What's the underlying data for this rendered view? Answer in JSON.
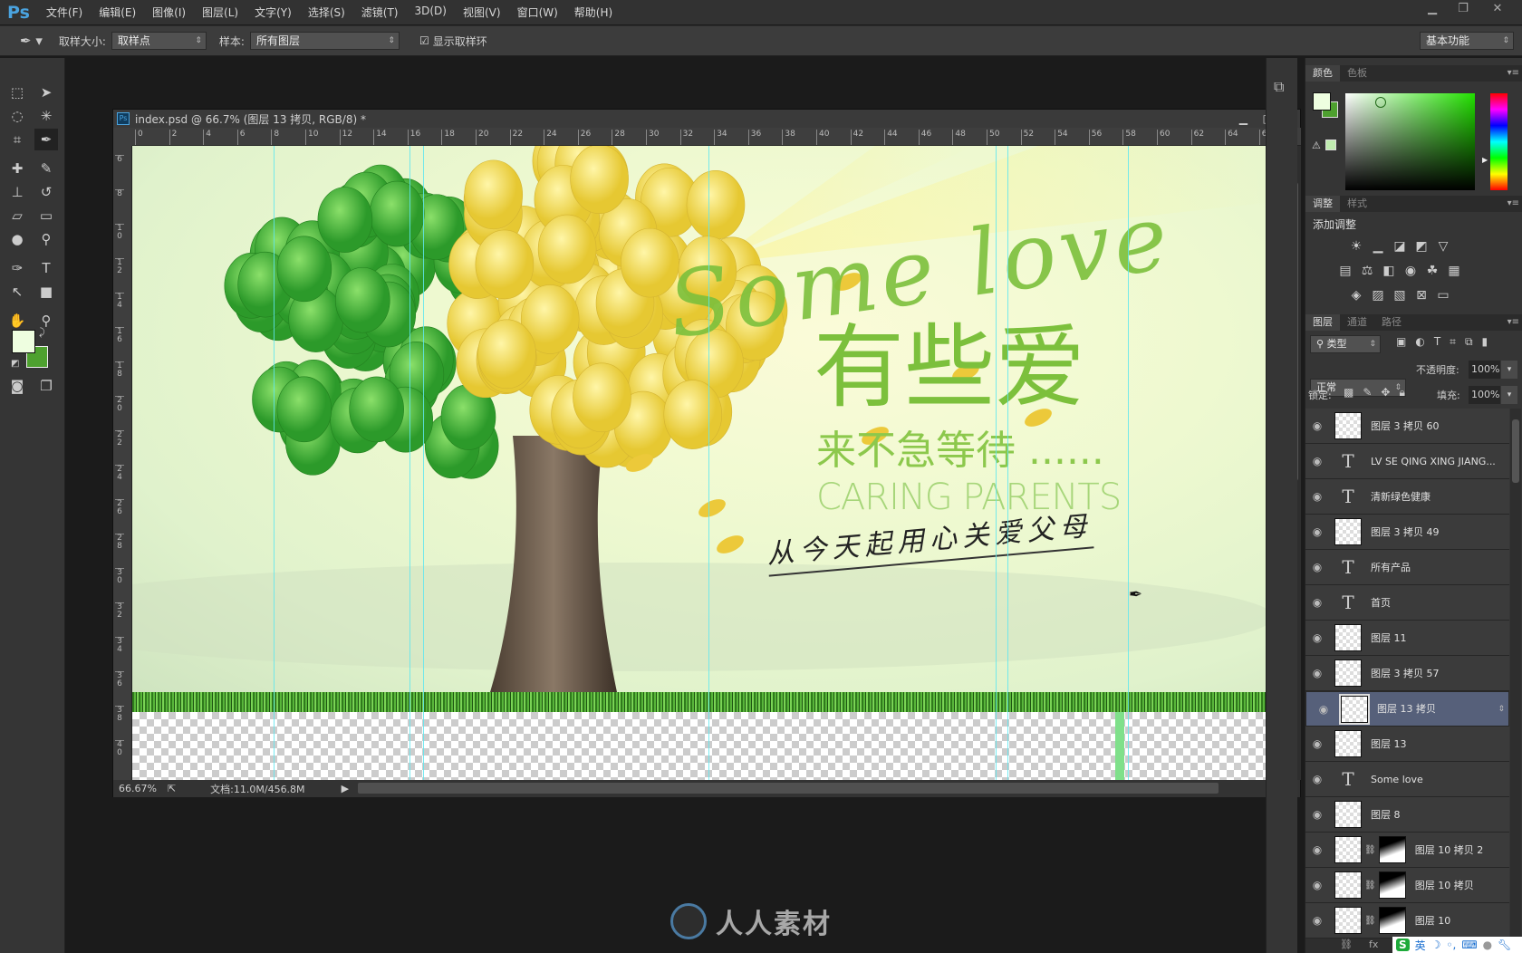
{
  "app": {
    "logo": "Ps",
    "menu": [
      "文件(F)",
      "编辑(E)",
      "图像(I)",
      "图层(L)",
      "文字(Y)",
      "选择(S)",
      "滤镜(T)",
      "3D(D)",
      "视图(V)",
      "窗口(W)",
      "帮助(H)"
    ],
    "window_controls": [
      "minimize-icon",
      "restore-icon",
      "close-icon"
    ]
  },
  "options": {
    "sample_size_label": "取样大小:",
    "sample_size_value": "取样点",
    "sample_label": "样本:",
    "sample_value": "所有图层",
    "show_ring_label": "显示取样环",
    "show_ring_checked": true,
    "workspace": "基本功能"
  },
  "tools": [
    {
      "icon": "marquee-icon",
      "glyph": "⬚"
    },
    {
      "icon": "move-icon",
      "glyph": "➤"
    },
    {
      "icon": "lasso-icon",
      "glyph": "◌"
    },
    {
      "icon": "magic-wand-icon",
      "glyph": "✳"
    },
    {
      "icon": "crop-icon",
      "glyph": "⌗"
    },
    {
      "icon": "eyedropper-icon",
      "glyph": "✒"
    },
    {
      "icon": "healing-brush-icon",
      "glyph": "✚"
    },
    {
      "icon": "brush-icon",
      "glyph": "✎"
    },
    {
      "icon": "clone-stamp-icon",
      "glyph": "⊥"
    },
    {
      "icon": "history-brush-icon",
      "glyph": "↺"
    },
    {
      "icon": "eraser-icon",
      "glyph": "▱"
    },
    {
      "icon": "gradient-icon",
      "glyph": "▭"
    },
    {
      "icon": "blur-icon",
      "glyph": "●"
    },
    {
      "icon": "dodge-icon",
      "glyph": "⚲"
    },
    {
      "icon": "pen-icon",
      "glyph": "✑"
    },
    {
      "icon": "type-icon",
      "glyph": "T"
    },
    {
      "icon": "path-select-icon",
      "glyph": "↖"
    },
    {
      "icon": "rectangle-icon",
      "glyph": "■"
    },
    {
      "icon": "hand-icon",
      "glyph": "✋"
    },
    {
      "icon": "zoom-icon",
      "glyph": "⚲"
    }
  ],
  "colors": {
    "foreground": "#eefee0",
    "background": "#4ea12f",
    "accent": "#7cc03c"
  },
  "document": {
    "title": "index.psd @ 66.7% (图层 13 拷贝, RGB/8) *",
    "zoom": "66.67%",
    "doc_size": "文档:11.0M/456.8M",
    "ruler_top": [
      "0",
      "2",
      "4",
      "6",
      "8",
      "10",
      "12",
      "14",
      "16",
      "18",
      "20",
      "22",
      "24",
      "26",
      "28",
      "30",
      "32",
      "34",
      "36",
      "38",
      "40",
      "42",
      "44",
      "46",
      "48",
      "50",
      "52",
      "54",
      "56",
      "58",
      "60",
      "62",
      "64",
      "66"
    ],
    "ruler_left": [
      "6",
      "8",
      "10",
      "12",
      "14",
      "16",
      "18",
      "20",
      "22",
      "24",
      "26",
      "28",
      "30",
      "32",
      "34",
      "36",
      "38",
      "40"
    ]
  },
  "banner": {
    "script_title": "Some love",
    "headline": "有些爱",
    "subline": "来不急等待 ......",
    "english": "CARING PARENTS",
    "handwriting": "从今天起用心关爱父母"
  },
  "color_panel": {
    "tabs": [
      "颜色",
      "色板"
    ]
  },
  "adjust_panel": {
    "tabs": [
      "调整",
      "样式"
    ],
    "title": "添加调整"
  },
  "layers_panel": {
    "tabs": [
      "图层",
      "通道",
      "路径"
    ],
    "filter": "类型",
    "blend_mode": "正常",
    "opacity_label": "不透明度:",
    "opacity": "100%",
    "lock_label": "锁定:",
    "fill_label": "填充:",
    "fill": "100%",
    "layers": [
      {
        "name": "图层 3 拷贝 60",
        "type": "pixel"
      },
      {
        "name": "LV SE QING XING JIANG...",
        "type": "text"
      },
      {
        "name": "清新绿色健康",
        "type": "text"
      },
      {
        "name": "图层 3 拷贝 49",
        "type": "pixel"
      },
      {
        "name": "所有产品",
        "type": "text"
      },
      {
        "name": "首页",
        "type": "text"
      },
      {
        "name": "图层 11",
        "type": "pixel"
      },
      {
        "name": "图层 3 拷贝 57",
        "type": "pixel"
      },
      {
        "name": "图层 13 拷贝",
        "type": "pixel",
        "selected": true
      },
      {
        "name": "图层 13",
        "type": "pixel"
      },
      {
        "name": "Some love",
        "type": "text"
      },
      {
        "name": "图层 8",
        "type": "pixel"
      },
      {
        "name": "图层 10 拷贝 2",
        "type": "masked"
      },
      {
        "name": "图层 10 拷贝",
        "type": "masked"
      },
      {
        "name": "图层 10",
        "type": "masked"
      }
    ]
  },
  "ime": {
    "label": "英"
  },
  "watermark": "人人素材"
}
